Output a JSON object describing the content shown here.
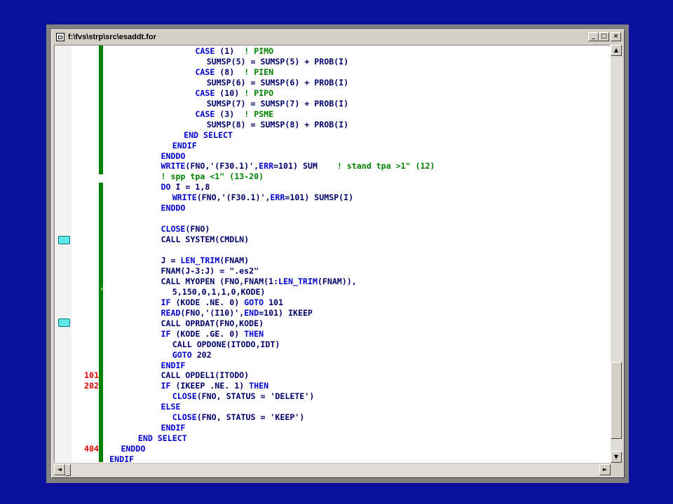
{
  "window": {
    "title": "f:\\fvs\\strp\\src\\esaddt.for"
  },
  "controls": {
    "minimize": "_",
    "maximize": "□",
    "close": "×"
  },
  "scroll": {
    "up": "▲",
    "down": "▼",
    "left": "◄",
    "right": "►",
    "vertical_position": 0.96,
    "horizontal_position": 0.0
  },
  "gutter": {
    "fold_marker": "›"
  },
  "code_lines": [
    {
      "label": "",
      "indent": 16,
      "text": "CASE (1)  ! PIMO"
    },
    {
      "label": "",
      "indent": 18,
      "text": "SUMSP(5) = SUMSP(5) + PROB(I)"
    },
    {
      "label": "",
      "indent": 16,
      "text": "CASE (8)  ! PIEN"
    },
    {
      "label": "",
      "indent": 18,
      "text": "SUMSP(6) = SUMSP(6) + PROB(I)"
    },
    {
      "label": "",
      "indent": 16,
      "text": "CASE (10) ! PIPO"
    },
    {
      "label": "",
      "indent": 18,
      "text": "SUMSP(7) = SUMSP(7) + PROB(I)"
    },
    {
      "label": "",
      "indent": 16,
      "text": "CASE (3)  ! PSME"
    },
    {
      "label": "",
      "indent": 18,
      "text": "SUMSP(8) = SUMSP(8) + PROB(I)"
    },
    {
      "label": "",
      "indent": 14,
      "text": "END SELECT"
    },
    {
      "label": "",
      "indent": 12,
      "text": "ENDIF"
    },
    {
      "label": "",
      "indent": 10,
      "text": "ENDDO"
    },
    {
      "label": "",
      "indent": 10,
      "text": "WRITE(FNO,'(F30.1)',ERR=101) SUM    ! stand tpa >1\" (12)"
    },
    {
      "label": "",
      "indent": 10,
      "text": "! spp tpa <1\" (13-20)"
    },
    {
      "label": "",
      "indent": 10,
      "text": "DO I = 1,8"
    },
    {
      "label": "",
      "indent": 12,
      "text": "WRITE(FNO,'(F30.1)',ERR=101) SUMSP(I)"
    },
    {
      "label": "",
      "indent": 10,
      "text": "ENDDO"
    },
    {
      "label": "",
      "indent": 10,
      "text": ""
    },
    {
      "label": "",
      "indent": 10,
      "text": "CLOSE(FNO)"
    },
    {
      "label": "",
      "indent": 10,
      "text": "CALL SYSTEM(CMDLN)"
    },
    {
      "label": "",
      "indent": 10,
      "text": ""
    },
    {
      "label": "",
      "indent": 10,
      "text": "J = LEN_TRIM(FNAM)"
    },
    {
      "label": "",
      "indent": 10,
      "text": "FNAM(J-3:J) = \".es2\""
    },
    {
      "label": "",
      "indent": 10,
      "text": "CALL MYOPEN (FNO,FNAM(1:LEN_TRIM(FNAM)),"
    },
    {
      "label": "",
      "indent": 12,
      "text": "5,150,0,1,1,0,KODE)"
    },
    {
      "label": "",
      "indent": 10,
      "text": "IF (KODE .NE. 0) GOTO 101"
    },
    {
      "label": "",
      "indent": 10,
      "text": "READ(FNO,'(I10)',END=101) IKEEP"
    },
    {
      "label": "",
      "indent": 10,
      "text": "CALL OPRDAT(FNO,KODE)"
    },
    {
      "label": "",
      "indent": 10,
      "text": "IF (KODE .GE. 0) THEN"
    },
    {
      "label": "",
      "indent": 12,
      "text": "CALL OPDONE(ITODO,IDT)"
    },
    {
      "label": "",
      "indent": 12,
      "text": "GOTO 202"
    },
    {
      "label": "",
      "indent": 10,
      "text": "ENDIF"
    },
    {
      "label": "101",
      "indent": 10,
      "text": "CALL OPDEL1(ITODO)"
    },
    {
      "label": "202",
      "indent": 10,
      "text": "IF (IKEEP .NE. 1) THEN"
    },
    {
      "label": "",
      "indent": 12,
      "text": "CLOSE(FNO, STATUS = 'DELETE')"
    },
    {
      "label": "",
      "indent": 10,
      "text": "ELSE"
    },
    {
      "label": "",
      "indent": 12,
      "text": "CLOSE(FNO, STATUS = 'KEEP')"
    },
    {
      "label": "",
      "indent": 10,
      "text": "ENDIF"
    },
    {
      "label": "",
      "indent": 6,
      "text": "END SELECT"
    },
    {
      "label": "404",
      "indent": 3,
      "text": "ENDDO"
    },
    {
      "label": "",
      "indent": 1,
      "text": "ENDIF"
    }
  ],
  "colors": {
    "background": "#0a0f9c",
    "keyword": "#0000d0",
    "comment": "#008000",
    "label": "#e00000",
    "text": "#00006a",
    "marker": "#5fe8e8",
    "changebar": "#008000"
  }
}
